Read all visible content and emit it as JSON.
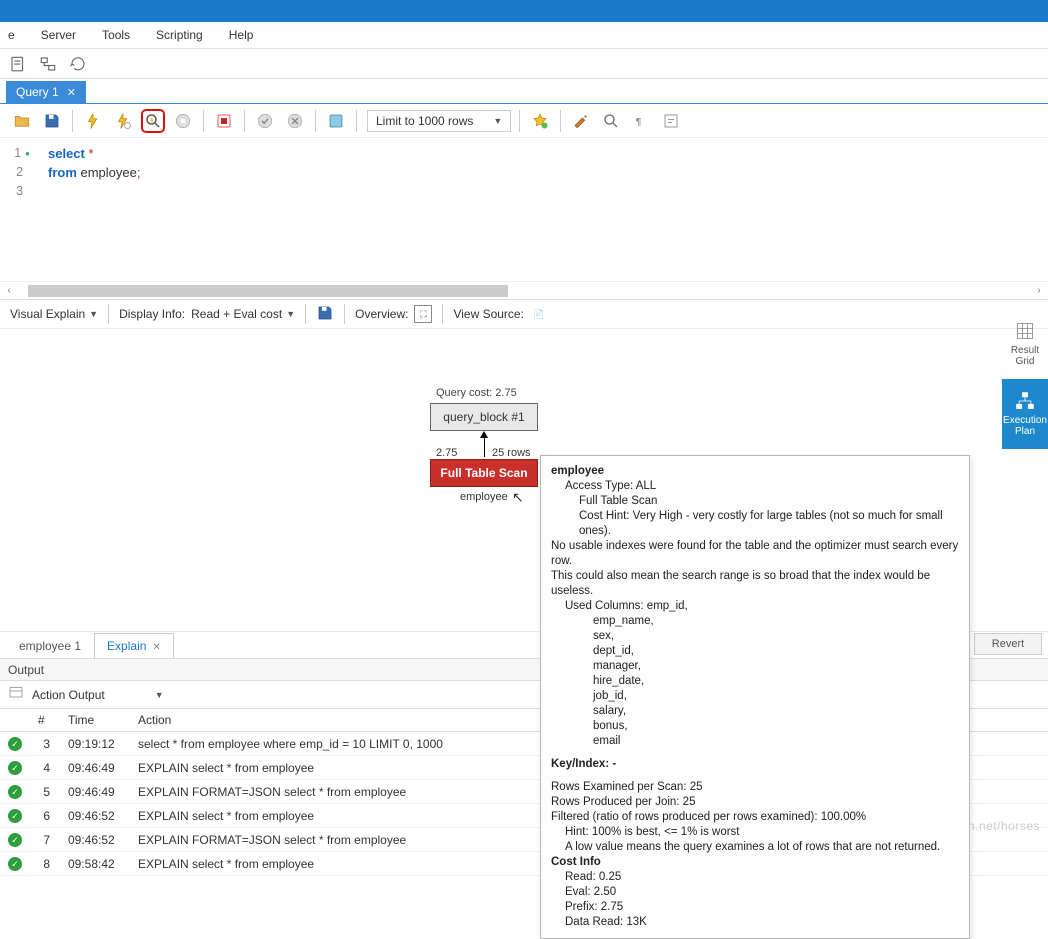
{
  "menu": {
    "items": [
      "e",
      "Server",
      "Tools",
      "Scripting",
      "Help"
    ]
  },
  "queryTab": {
    "label": "Query 1"
  },
  "limit": "Limit to 1000 rows",
  "code": {
    "line1_kw": "select",
    "line1_rest": " *",
    "line2_kw": "from",
    "line2_rest": " employee",
    "line2_semi": ";"
  },
  "vebar": {
    "mode": "Visual Explain",
    "displayInfoLabel": "Display Info:",
    "displayInfo": "Read + Eval cost",
    "overview": "Overview:",
    "viewSource": "View Source:"
  },
  "explain": {
    "queryCostLabel": "Query cost: 2.75",
    "blockLabel": "query_block #1",
    "arrLeft": "2.75",
    "arrRight": "25 rows",
    "scanLabel": "Full Table Scan",
    "tableName": "employee"
  },
  "tooltip": {
    "title": "employee",
    "accessTypeLabel": "Access Type: ALL",
    "accessTypeDetail": "Full Table Scan",
    "costHint": "Cost Hint: Very High - very costly for large tables (not so much for small ones).",
    "noIndex": "No usable indexes were found for the table and the optimizer must search every row.",
    "broad": "This could also mean the search range is so broad that the index would be useless.",
    "usedColsLabel": "Used Columns:  emp_id,",
    "cols": [
      "emp_name,",
      "sex,",
      "dept_id,",
      "manager,",
      "hire_date,",
      "job_id,",
      "salary,",
      "bonus,",
      "email"
    ],
    "keyIndex": "Key/Index:  -",
    "rowsExamined": "Rows Examined per Scan:  25",
    "rowsProduced": "Rows Produced per Join:  25",
    "filtered": "Filtered (ratio of rows produced per rows examined):  100.00%",
    "hint": "Hint:  100% is best, <= 1% is worst",
    "lowVal": "A low value means the query examines a lot of rows that are not returned.",
    "costInfoLabel": "Cost Info",
    "read": "Read: 0.25",
    "eval": "Eval: 2.50",
    "prefix": "Prefix: 2.75",
    "dataRead": "Data Read: 13K"
  },
  "rightPanel": {
    "resultGrid": "Result\nGrid",
    "execPlan": "Execution\nPlan"
  },
  "lowerTabs": {
    "t1": "employee 1",
    "t2": "Explain"
  },
  "revert": "Revert",
  "outputHeader": "Output",
  "actionOutput": "Action Output",
  "table": {
    "headers": {
      "idx": "#",
      "time": "Time",
      "action": "Action"
    },
    "rows": [
      {
        "idx": "3",
        "time": "09:19:12",
        "action": "select * from employee where emp_id = 10 LIMIT 0, 1000"
      },
      {
        "idx": "4",
        "time": "09:46:49",
        "action": "EXPLAIN select * from employee"
      },
      {
        "idx": "5",
        "time": "09:46:49",
        "action": "EXPLAIN FORMAT=JSON select * from employee"
      },
      {
        "idx": "6",
        "time": "09:46:52",
        "action": "EXPLAIN select * from employee"
      },
      {
        "idx": "7",
        "time": "09:46:52",
        "action": "EXPLAIN FORMAT=JSON select * from employee"
      },
      {
        "idx": "8",
        "time": "09:58:42",
        "action": "EXPLAIN select * from employee"
      }
    ]
  },
  "watermark": "https://blog.csdn.net/horses"
}
